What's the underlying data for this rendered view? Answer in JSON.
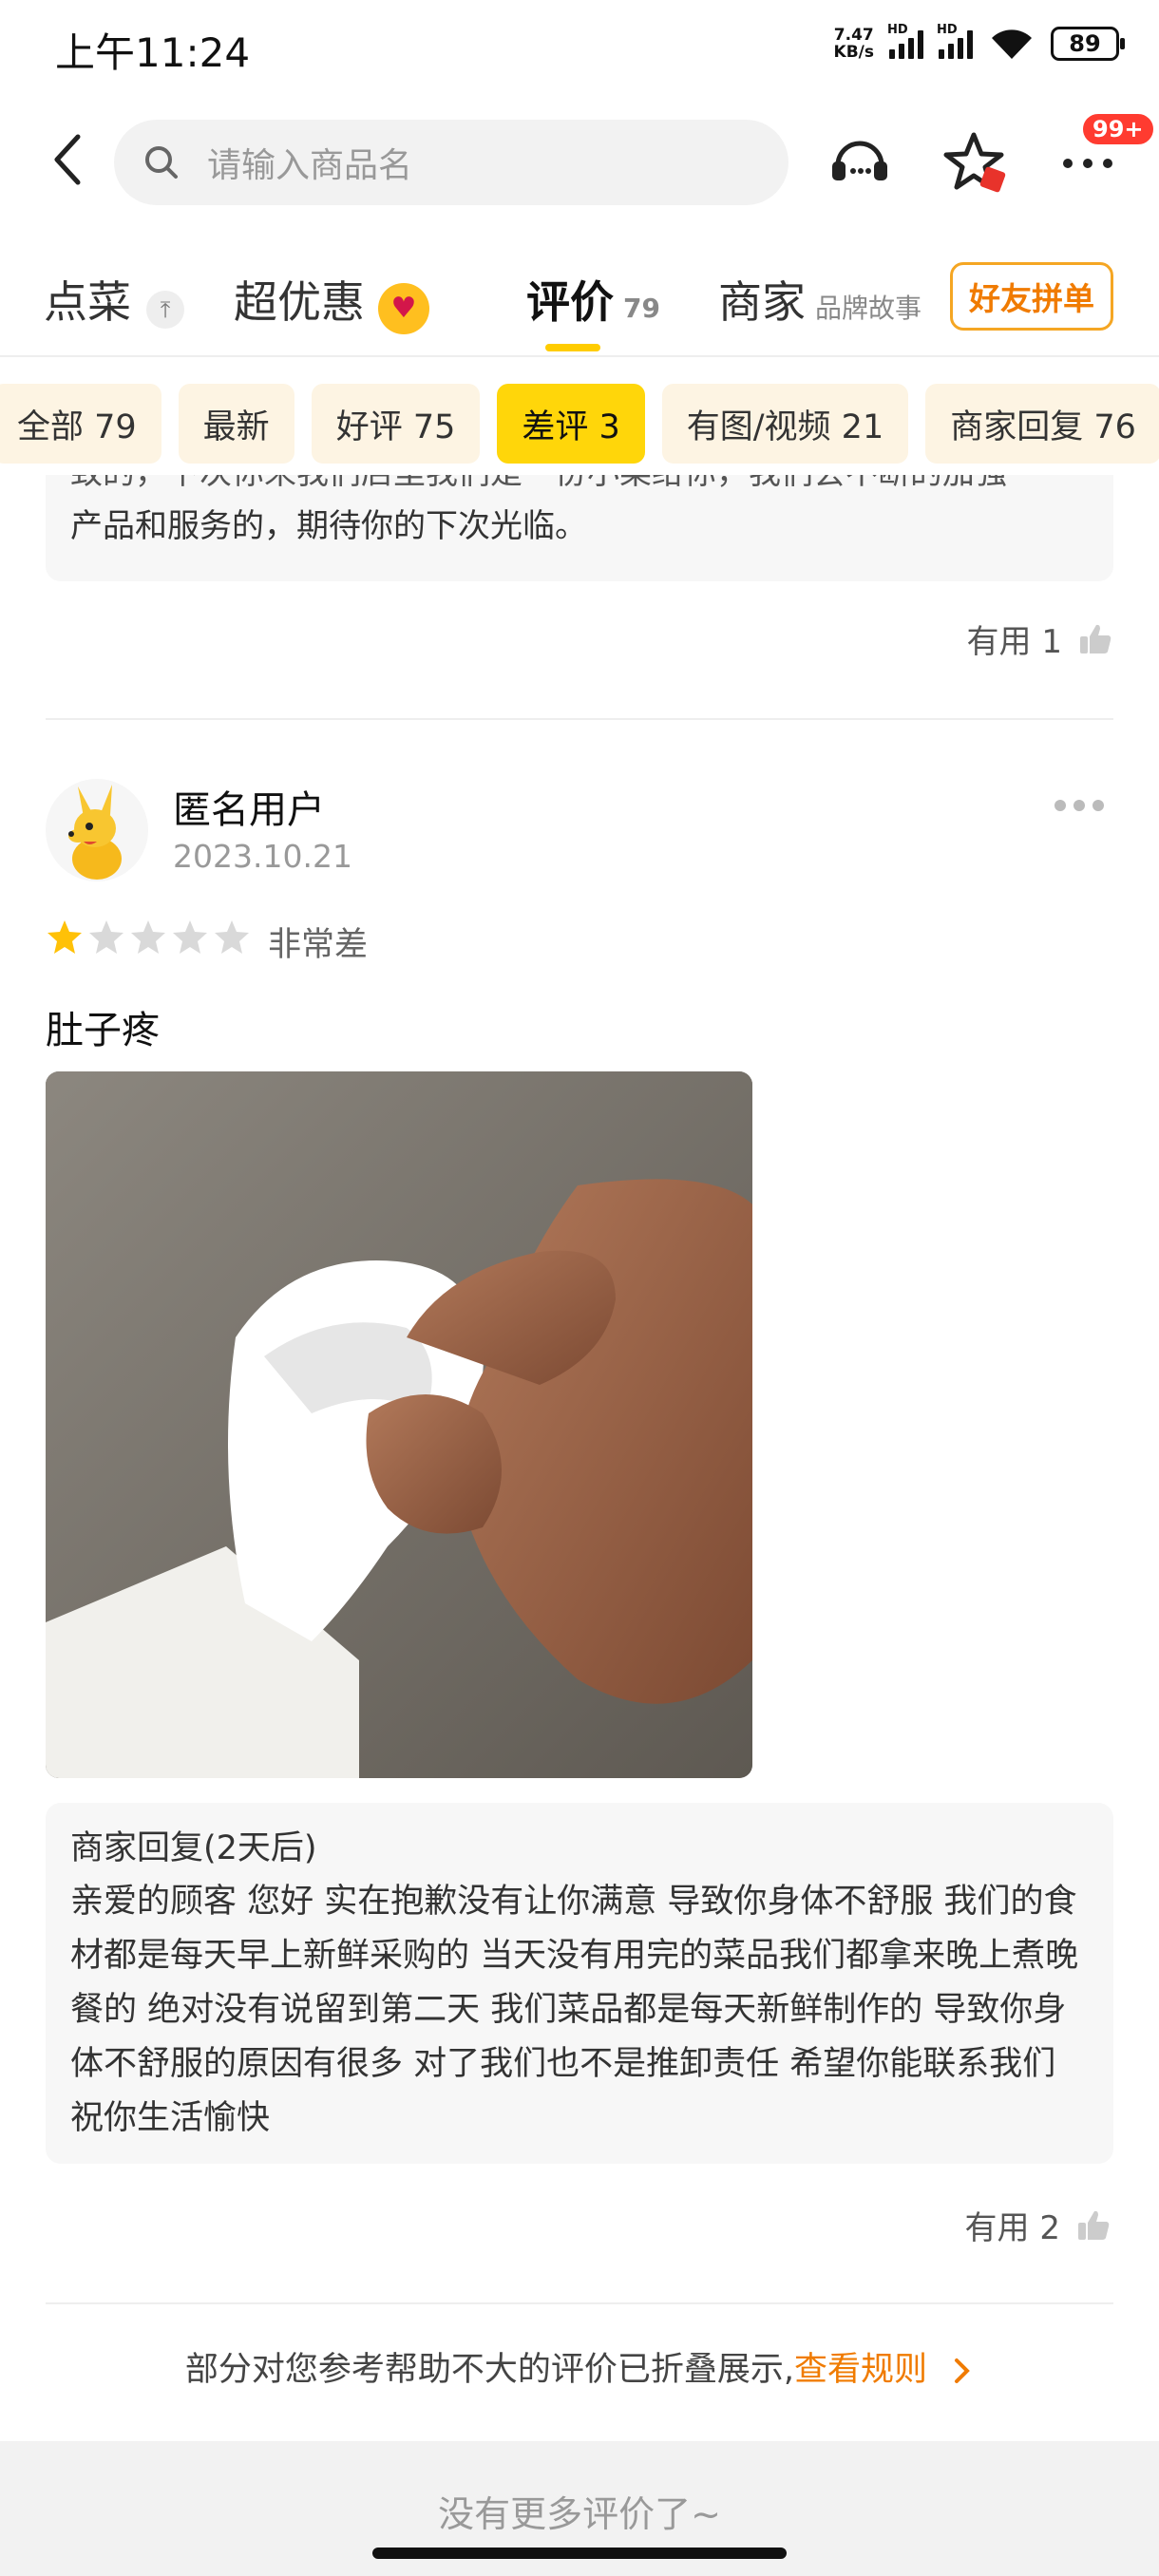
{
  "status_bar": {
    "time": "上午11:24",
    "net_speed_value": "7.47",
    "net_speed_unit": "KB/s",
    "hd1": "HD",
    "hd2": "HD",
    "battery": "89"
  },
  "header": {
    "search_placeholder": "请输入商品名",
    "notification_badge": "99+"
  },
  "tabs": [
    {
      "label": "点菜",
      "sub": ""
    },
    {
      "label": "超优惠",
      "sub": ""
    },
    {
      "label": "评价",
      "sub": "79"
    },
    {
      "label": "商家",
      "sub": "品牌故事"
    }
  ],
  "group_button": "好友拼单",
  "filters": [
    "全部 79",
    "最新",
    "好评 75",
    "差评 3",
    "有图/视频 21",
    "商家回复 76"
  ],
  "active_filter_index": 3,
  "previous_review": {
    "reply_partial_line1": "致的，下次你来我们店里我们是一份小菜给你，我们会不断的加强",
    "reply_partial_line2": "产品和服务的，期待你的下次光临。",
    "useful_label": "有用 1"
  },
  "review": {
    "user_name": "匿名用户",
    "date": "2023.10.21",
    "star_rating": 1,
    "star_max": 5,
    "rating_text": "非常差",
    "comment": "肚子疼",
    "reply_title": "商家回复(2天后)",
    "reply_body": "亲爱的顾客 您好 实在抱歉没有让你满意 导致你身体不舒服 我们的食材都是每天早上新鲜采购的 当天没有用完的菜品我们都拿来晚上煮晚餐的 绝对没有说留到第二天 我们菜品都是每天新鲜制作的 导致你身体不舒服的原因有很多 对了我们也不是推卸责任 希望你能联系我们 祝你生活愉快",
    "useful_label": "有用 2"
  },
  "footer": {
    "fold_notice": "部分对您参考帮助不大的评价已折叠展示,",
    "fold_link": "查看规则",
    "no_more": "没有更多评价了~"
  },
  "colors": {
    "accent_yellow": "#ffd60a",
    "accent_orange": "#f07b00",
    "badge_red": "#ff3b30",
    "star_active": "#ffc107",
    "star_inactive": "#d9d9d9"
  }
}
